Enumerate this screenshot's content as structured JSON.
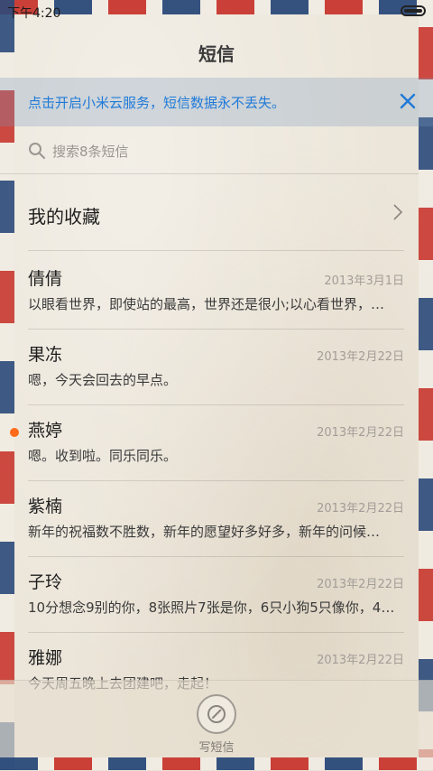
{
  "status_bar": {
    "time": "下午4:20"
  },
  "header": {
    "title": "短信"
  },
  "banner": {
    "text": "点击开启小米云服务，短信数据永不丢失。"
  },
  "search": {
    "placeholder": "搜索8条短信"
  },
  "favorites": {
    "label": "我的收藏"
  },
  "messages": [
    {
      "name": "倩倩",
      "date": "2013年3月1日",
      "preview": "以眼看世界，即使站的最高，世界还是很小;以心看世界，…",
      "unread": false
    },
    {
      "name": "果冻",
      "date": "2013年2月22日",
      "preview": "嗯，今天会回去的早点。",
      "unread": false
    },
    {
      "name": "燕婷",
      "date": "2013年2月22日",
      "preview": "嗯。收到啦。同乐同乐。",
      "unread": true
    },
    {
      "name": "紫楠",
      "date": "2013年2月22日",
      "preview": "新年的祝福数不胜数，新年的愿望好多好多，新年的问候…",
      "unread": false
    },
    {
      "name": "子玲",
      "date": "2013年2月22日",
      "preview": "10分想念9别的你，8张照片7张是你，6只小狗5只像你，4…",
      "unread": false
    },
    {
      "name": "雅娜",
      "date": "2013年2月22日",
      "preview": "今天周五晚上去团建吧，走起！",
      "unread": false
    }
  ],
  "bottom": {
    "compose_label": "写短信"
  },
  "colors": {
    "accent": "#1f7ad8",
    "unread": "#ff6a1a",
    "stripe_red": "#c8372f",
    "stripe_blue": "#2b4a7a"
  }
}
